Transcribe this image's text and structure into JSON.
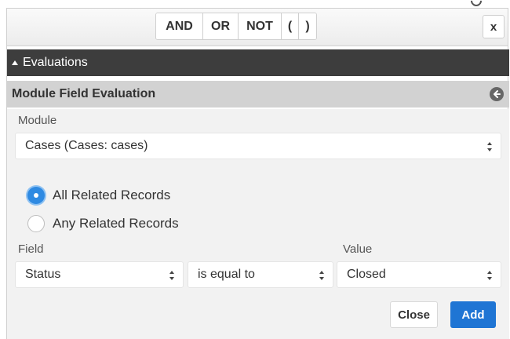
{
  "toolbar": {
    "operators": [
      "AND",
      "OR",
      "NOT",
      "(",
      ")"
    ],
    "close_label": "x"
  },
  "evaluations": {
    "title": "Evaluations"
  },
  "module_field_evaluation": {
    "title": "Module Field Evaluation",
    "module_label": "Module",
    "module_value": "Cases (Cases: cases)",
    "radio_options": [
      {
        "label": "All Related Records",
        "selected": true
      },
      {
        "label": "Any Related Records",
        "selected": false
      }
    ],
    "field_label": "Field",
    "value_label": "Value",
    "field_value": "Status",
    "operator_value": "is equal to",
    "value_value": "Closed"
  },
  "actions": {
    "close_label": "Close",
    "add_label": "Add"
  },
  "colors": {
    "primary": "#1f75d4",
    "evaluations_bar": "#3d3d3d",
    "section_header": "#d2d2d2",
    "radio_selected": "#2f8ae2"
  }
}
